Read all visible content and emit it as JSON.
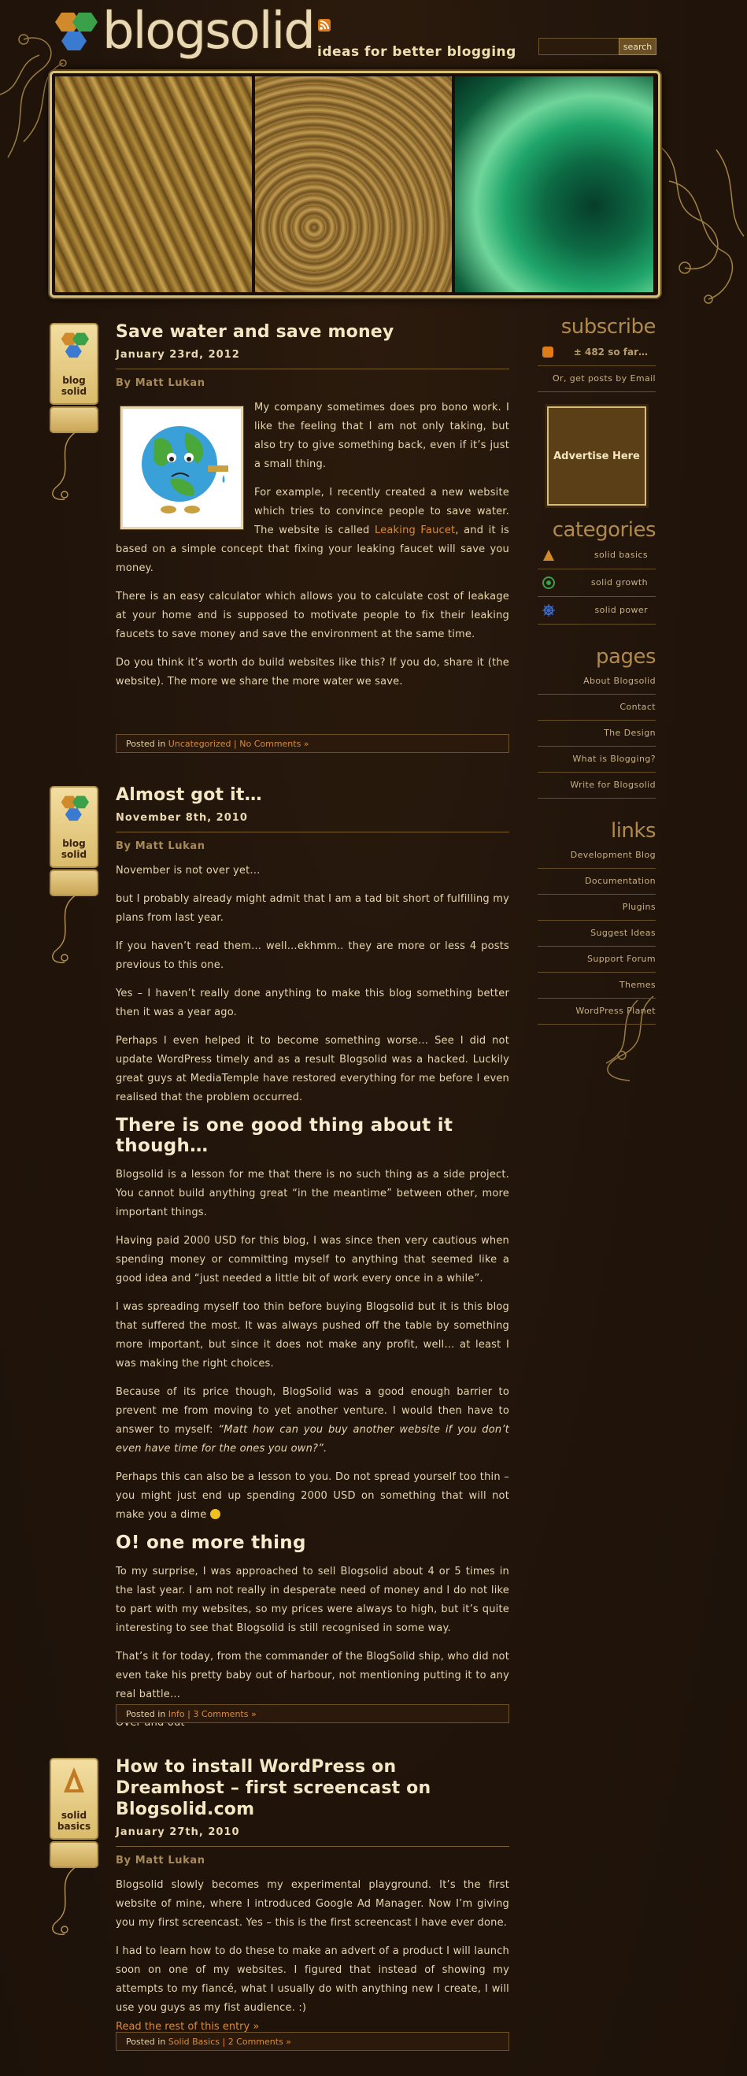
{
  "header": {
    "logo_text": "blogsolid",
    "tagline": "ideas for better blogging",
    "search_button": "search",
    "search_value": ""
  },
  "posts": [
    {
      "badge": "blog solid",
      "title": "Save water and save money",
      "date": "January 23rd, 2012",
      "author": "By Matt Lukan",
      "paragraphs": [
        "My company sometimes does pro bono work. I like the feeling that I am not only taking, but also try to give something back, even if it’s just a small thing.",
        "For example, I recently created a new website which tries to convince people to save water. The website is called",
        "Leaking Faucet",
        ", and it is based on a simple concept that fixing your leaking faucet will save you money.",
        "There is an easy calculator which allows you to calculate cost of leakage at your home and is supposed to motivate people to fix their leaking faucets to save money and save the environment at the same time.",
        "Do you think it’s worth do build websites like this? If you do, share it (the website). The more we share the more water we save."
      ],
      "meta": {
        "posted_in": "Posted in",
        "category": "Uncategorized",
        "comments": "No Comments »"
      }
    },
    {
      "badge": "blog solid",
      "title": "Almost got it…",
      "date": "November 8th, 2010",
      "author": "By Matt Lukan",
      "paragraphs": [
        "November is not over yet…",
        "but I probably already might admit that I am a tad bit short of fulfilling my plans from last year.",
        "If you haven’t read them… well…ekhmm.. they are more or less 4 posts previous to this one.",
        "Yes – I haven’t really done anything to make this blog something better then it was a year ago.",
        "Perhaps I even helped it to become something worse… See I did not update WordPress timely and as a result Blogsolid was a hacked. Luckily great guys at MediaTemple have restored everything for me before I even realised that the problem occurred."
      ],
      "heading_1": "There is one good thing about it though…",
      "paragraphs_2": [
        "Blogsolid is a lesson for me that there is no such thing as a side project. You cannot build anything great “in the meantime” between other, more important things.",
        "Having paid 2000 USD for this blog, I was since then very cautious when spending money or committing myself to anything that seemed like a good idea and “just needed a little bit of work every once in a while”.",
        "I was spreading myself too thin before buying Blogsolid but it is this blog that suffered the most. It was always pushed off the table by something more important, but since it does not make any profit, well… at least I was making the right choices.",
        "Because of its price though, BlogSolid was a good enough barrier to prevent me from moving to yet another venture. I would then have to answer to myself:",
        "“Matt how can you buy another website if you don’t even have time for the ones you own?”.",
        "Perhaps this can also be a lesson to you. Do not spread yourself too thin – you might just end up spending 2000 USD on something that will not make you a dime"
      ],
      "heading_2": "O! one more thing",
      "paragraphs_3": [
        "To my surprise, I was approached to sell Blogsolid about 4 or 5 times in the last year. I am not really in desperate need of money and I do not like to part with my websites, so my prices were always to high, but it’s quite interesting to see that Blogsolid is still recognised in some way.",
        "That’s it for today, from the commander of the BlogSolid ship, who did not even take his pretty baby out of harbour, not mentioning putting it to any real battle…",
        "Over and out"
      ],
      "meta": {
        "posted_in": "Posted in",
        "category": "Info",
        "comments": "3 Comments »"
      }
    },
    {
      "badge": "solid basics",
      "title": "How to install WordPress on Dreamhost – first screencast on Blogsolid.com",
      "date": "January 27th, 2010",
      "author": "By Matt Lukan",
      "paragraphs": [
        "Blogsolid slowly becomes my experimental playground. It’s the first website of mine, where I introduced Google Ad Manager. Now I’m giving you my first screencast. Yes – this is the first screencast I have ever done.",
        "I had to learn how to do these to make an advert of a product I will launch soon on one of my websites. I figured that instead of showing my attempts to my fiancé, what I usually do with anything new I create, I will use you guys as my fist audience.  :)"
      ],
      "read_more": "Read the rest of this entry »",
      "meta": {
        "posted_in": "Posted in",
        "category": "Solid Basics",
        "comments": "2 Comments »"
      }
    }
  ],
  "sidebar": {
    "subscribe_heading": "subscribe",
    "subscribers": "± 482 so far…",
    "email_link": "Or, get posts by Email",
    "ad_label": "Advertise Here",
    "categories_heading": "categories",
    "categories": [
      {
        "label": "solid basics",
        "icon": "solid-basics-icon",
        "color": "#d08a2a"
      },
      {
        "label": "solid growth",
        "icon": "solid-growth-icon",
        "color": "#3aa04a"
      },
      {
        "label": "solid power",
        "icon": "solid-power-icon",
        "color": "#3a6ad0"
      }
    ],
    "pages_heading": "pages",
    "pages": [
      "About Blogsolid",
      "Contact",
      "The Design",
      "What is Blogging?",
      "Write for Blogsolid"
    ],
    "links_heading": "links",
    "links": [
      "Development Blog",
      "Documentation",
      "Plugins",
      "Suggest Ideas",
      "Support Forum",
      "Themes",
      "WordPress Planet"
    ]
  },
  "colors": {
    "background": "#22150b",
    "accent": "#d98a3a",
    "text": "#e6d5af"
  }
}
